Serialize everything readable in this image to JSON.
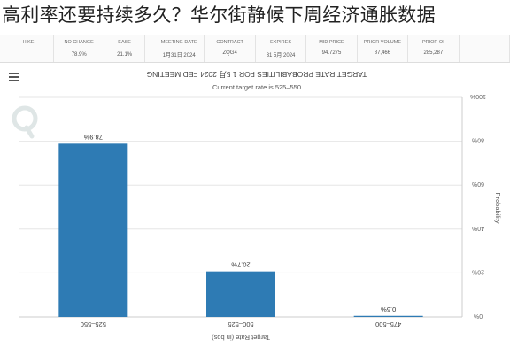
{
  "headline": "高利率还要持续多久？华尔街静候下周经济通胀数据",
  "table_left": {
    "headers": [
      "HIKE",
      "NO CHANGE",
      "EASE"
    ],
    "values": [
      "",
      "78.9%",
      "21.1%"
    ]
  },
  "table_right": {
    "headers": [
      "MEETING DATE",
      "CONTRACT",
      "EXPIRES",
      "MID PRICE",
      "PRIOR VOLUME",
      "PRIOR OI",
      ""
    ],
    "values": [
      "1月31日 2024",
      "ZQG4",
      "31 5月 2024",
      "94.7275",
      "87,466",
      "285,287",
      ""
    ]
  },
  "icons": {
    "menu": "menu-icon",
    "watermark": "watermark-logo-icon"
  },
  "chart_data": {
    "type": "bar",
    "title": "TARGET RATE PROBABILITIES FOR 1 5月 2024 FED MEETING",
    "subtitle": "Current target rate is 525–550",
    "categories": [
      "525–550",
      "500–525",
      "475–500"
    ],
    "values": [
      78.9,
      20.7,
      0.5
    ],
    "value_labels": [
      "78.9%",
      "20.7%",
      "0.5%"
    ],
    "xlabel": "Target Rate (in bps)",
    "ylabel": "Probability",
    "ylim": [
      0,
      100
    ],
    "yticks": [
      "0%",
      "20%",
      "40%",
      "60%",
      "80%",
      "100%"
    ],
    "grid": true,
    "bar_color": "#2e7bb4"
  }
}
